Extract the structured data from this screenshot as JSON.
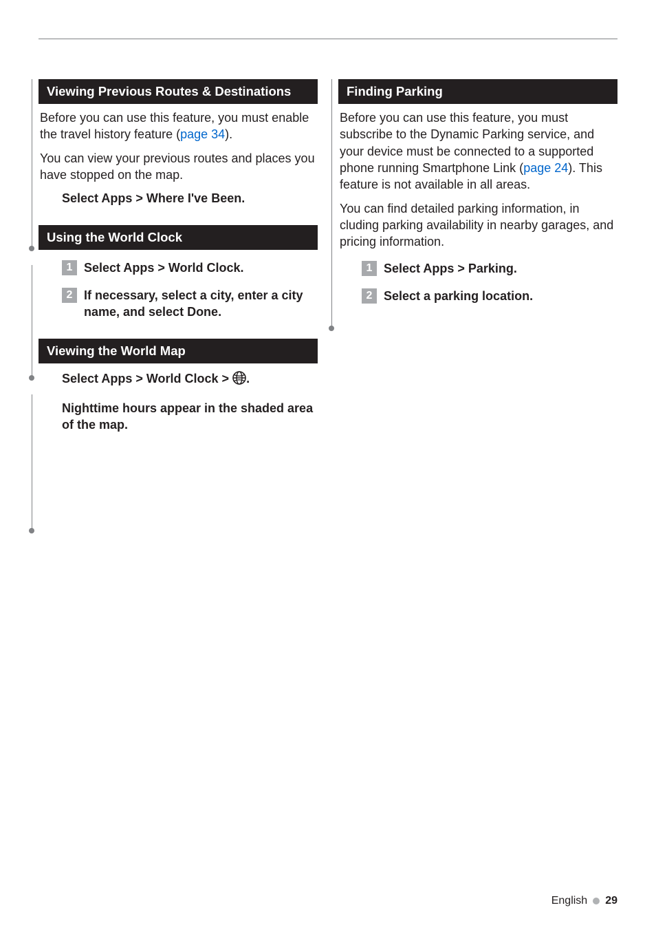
{
  "left": {
    "sec1": {
      "title": "Viewing Previous Routes & Destinations",
      "p1a": "Before you can use this feature, you must enable the travel history feature (",
      "p1_link": "page 34",
      "p1b": ").",
      "p2": "You can view your previous routes and places you have stopped on the map.",
      "step1": "Select Apps > Where I've Been."
    },
    "sec2": {
      "title": "Using the World Clock",
      "step1": "Select Apps > World Clock.",
      "step2": "If necessary, select a city, enter a city name, and select Done."
    },
    "sec3": {
      "title": "Viewing the World Map",
      "line1_pre": "Select Apps > World Clock > ",
      "line1_post": ".",
      "line2": "Nighttime hours appear in the shaded area of the map."
    }
  },
  "right": {
    "sec1": {
      "title": "Finding Parking",
      "p1a": "Before you can use this feature, you must subscribe to the Dynamic Parking service, and your device must be connected to a supported phone running Smartphone Link (",
      "p1_link": "page 24",
      "p1b": "). This feature is not available in all areas.",
      "p2": "You can find detailed parking information, in cluding parking availability in nearby garages, and pricing information.",
      "step1": "Select Apps > Parking.",
      "step2": "Select a parking location."
    }
  },
  "footer": {
    "lang": "English",
    "page": "29"
  },
  "step_numbers": {
    "n1": "1",
    "n2": "2"
  }
}
